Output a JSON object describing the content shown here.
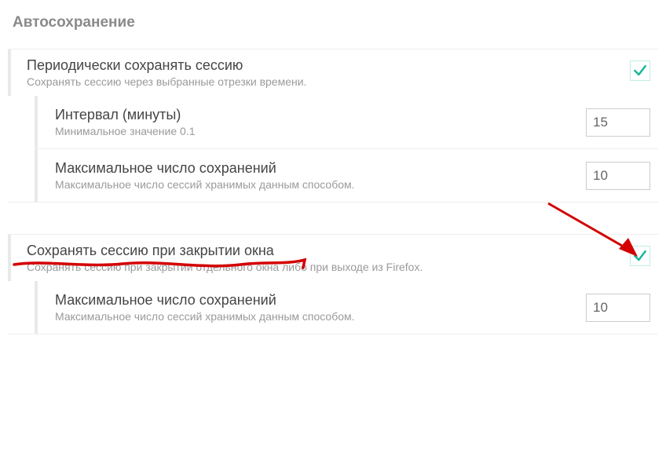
{
  "section_title": "Автосохранение",
  "periodic": {
    "title": "Периодически сохранять сессию",
    "desc": "Сохранять сессию через выбранные отрезки времени.",
    "checked": true,
    "interval": {
      "title": "Интервал (минуты)",
      "desc": "Минимальное значение 0.1",
      "value": "15"
    },
    "max_saves": {
      "title": "Максимальное число сохранений",
      "desc": "Максимальное число сессий хранимых данным способом.",
      "value": "10"
    }
  },
  "on_close": {
    "title": "Сохранять сессию при закрытии окна",
    "desc": "Сохранять сессию при закрытии отдельного окна либо при выходе из Firefox.",
    "checked": true,
    "max_saves": {
      "title": "Максимальное число сохранений",
      "desc": "Максимальное число сессий хранимых данным способом.",
      "value": "10"
    }
  }
}
